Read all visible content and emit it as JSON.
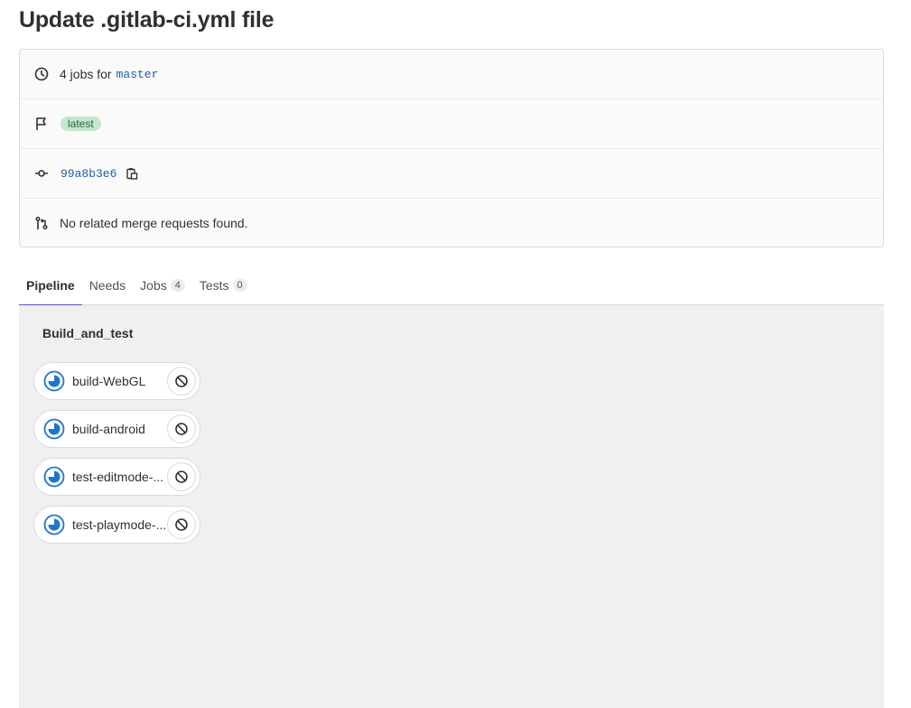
{
  "page": {
    "title": "Update .gitlab-ci.yml file"
  },
  "info": {
    "jobs_text": "4 jobs for",
    "branch": "master",
    "badge": "latest",
    "commit_sha": "99a8b3e6",
    "merge_text": "No related merge requests found."
  },
  "tabs": [
    {
      "label": "Pipeline",
      "count": null
    },
    {
      "label": "Needs",
      "count": null
    },
    {
      "label": "Jobs",
      "count": "4"
    },
    {
      "label": "Tests",
      "count": "0"
    }
  ],
  "stage": {
    "title": "Build_and_test",
    "jobs": [
      {
        "name": "build-WebGL",
        "status": "running-icon",
        "action": "cancel-icon"
      },
      {
        "name": "build-android",
        "status": "running-icon",
        "action": "cancel-icon"
      },
      {
        "name": "test-editmode-...",
        "status": "running-icon",
        "action": "cancel-icon"
      },
      {
        "name": "test-playmode-...",
        "status": "running-icon",
        "action": "cancel-icon"
      }
    ]
  },
  "colors": {
    "link": "#1f5fa8",
    "badge_bg": "#c3e6cd",
    "badge_text": "#24663b",
    "active_tab": "#6e49cb",
    "running": "#1f75cb",
    "pipeline_bg": "#f0f0f0"
  }
}
